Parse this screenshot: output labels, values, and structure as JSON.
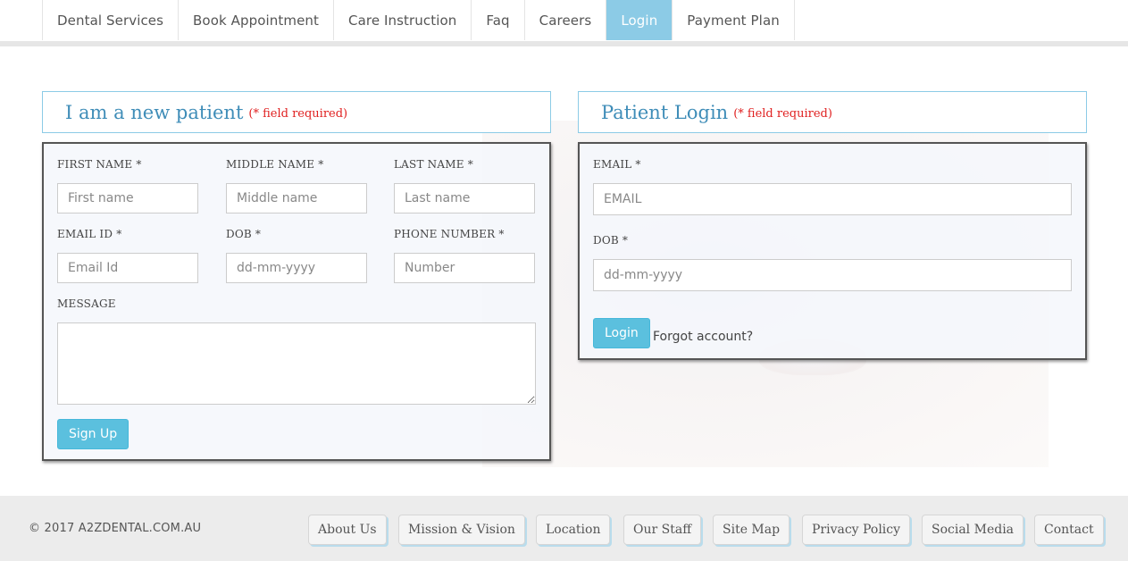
{
  "nav": {
    "items": [
      {
        "label": "Dental Services",
        "active": false
      },
      {
        "label": "Book Appointment",
        "active": false
      },
      {
        "label": "Care Instruction",
        "active": false
      },
      {
        "label": "Faq",
        "active": false
      },
      {
        "label": "Careers",
        "active": false
      },
      {
        "label": "Login",
        "active": true
      },
      {
        "label": "Payment Plan",
        "active": false
      }
    ]
  },
  "signup": {
    "title": "I am a new patient",
    "required_note": "(* field required)",
    "first_name_label": "FIRST NAME *",
    "first_name_placeholder": "First name",
    "middle_name_label": "MIDDLE NAME *",
    "middle_name_placeholder": "Middle name",
    "last_name_label": "LAST NAME *",
    "last_name_placeholder": "Last name",
    "email_label": "EMAIL ID *",
    "email_placeholder": "Email Id",
    "dob_label": "DOB *",
    "dob_placeholder": "dd-mm-yyyy",
    "phone_label": "PHONE NUMBER *",
    "phone_placeholder": "Number",
    "message_label": "MESSAGE",
    "submit_label": "Sign Up"
  },
  "login": {
    "title": "Patient Login",
    "required_note": "(* field required)",
    "email_label": "EMAIL *",
    "email_placeholder": "EMAIL",
    "dob_label": "DOB *",
    "dob_placeholder": "dd-mm-yyyy",
    "submit_label": "Login",
    "forgot_label": "Forgot account?"
  },
  "footer": {
    "copyright": "© 2017 A2ZDENTAL.COM.AU",
    "links": [
      "About Us",
      "Mission & Vision",
      "Location",
      "Our Staff",
      "Site Map",
      "Privacy Policy",
      "Social Media",
      "Contact"
    ]
  },
  "colors": {
    "accent": "#5bc0de",
    "nav_active": "#8ccbe6",
    "title": "#3f8db8",
    "required": "#e02020"
  }
}
